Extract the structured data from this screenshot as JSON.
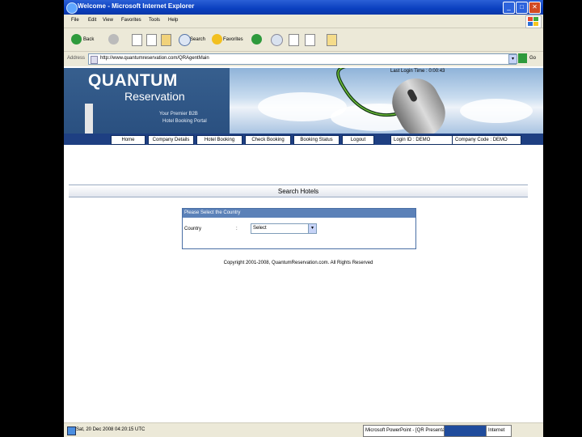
{
  "window": {
    "title": "Welcome - Microsoft Internet Explorer"
  },
  "menu": [
    "File",
    "Edit",
    "View",
    "Favorites",
    "Tools",
    "Help"
  ],
  "toolbar": {
    "back": "Back",
    "search": "Search",
    "favorites": "Favorites"
  },
  "address": {
    "label": "Address",
    "url": "http://www.quantumreservation.com/QRAgentMain",
    "go": "Go"
  },
  "banner": {
    "logo": "QUANTUM",
    "subtitle": "Reservation",
    "tagline1": "Your Premier B2B",
    "tagline2": "Hotel Booking Portal",
    "last_login": "Last Login Time : 0:00:43"
  },
  "nav": {
    "items": [
      "Home",
      "Company Details",
      "Hotel Booking",
      "Check Booking",
      "Booking Status",
      "Logout"
    ],
    "login_id": "Login ID : DEMO",
    "company_code": "Company Code : DEMO"
  },
  "search": {
    "header": "Search Hotels",
    "panel_title": "Please Select the Country",
    "country_label": "Country",
    "colon": ":",
    "select_value": "Select"
  },
  "footer": {
    "copyright": "Copyright 2001-2008, QuantumReservation.com. All Rights Reserved"
  },
  "status": {
    "text": "Sat, 20 Dec 2008 04:20:15 UTC",
    "tasks": [
      "Microsoft PowerPoint - [QR Presentation Update.ppt]",
      "Internet"
    ]
  }
}
